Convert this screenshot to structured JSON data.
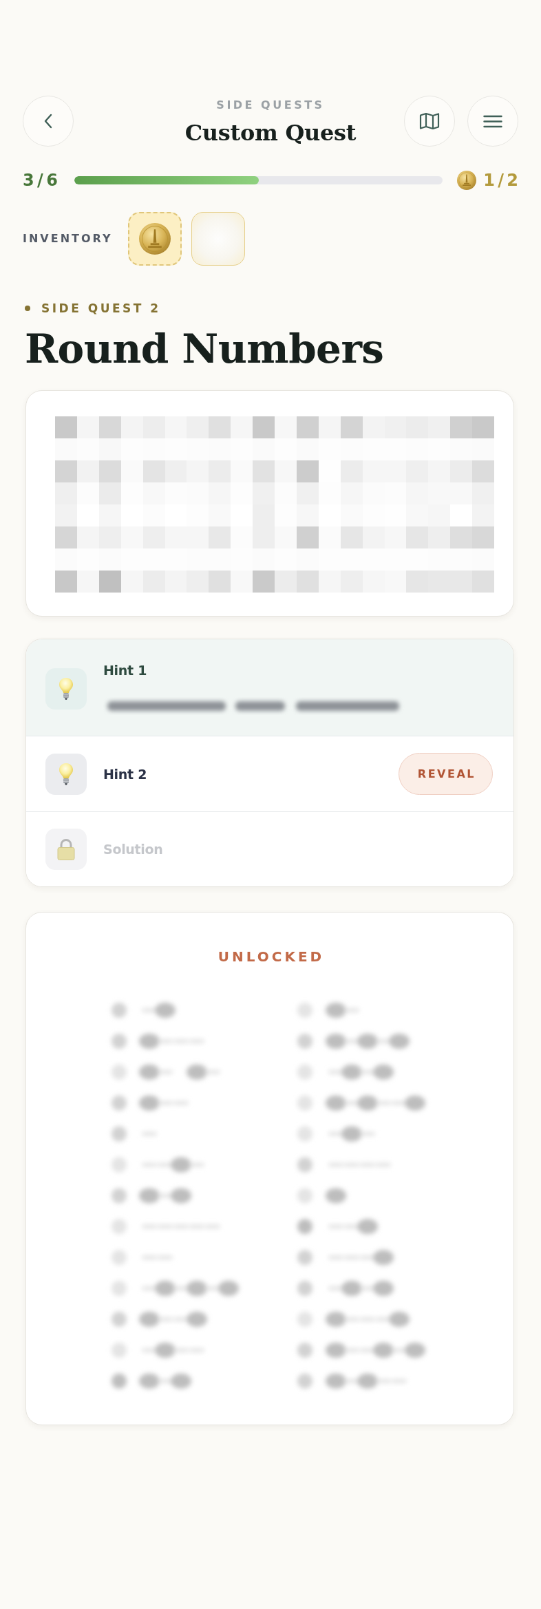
{
  "header": {
    "eyebrow": "SIDE QUESTS",
    "title": "Custom Quest"
  },
  "progress": {
    "count": "3 / 6",
    "level": 0.5,
    "coins": "1 / 2"
  },
  "inventory": {
    "label": "INVENTORY",
    "slots": [
      {
        "kind": "coin"
      },
      {
        "kind": "empty"
      }
    ]
  },
  "quest": {
    "eyebrow": "SIDE QUEST 2",
    "title": "Round Numbers"
  },
  "hints": [
    {
      "title": "Hint 1",
      "revealed": true,
      "locked": false
    },
    {
      "title": "Hint 2",
      "revealed": false,
      "locked": false,
      "button": "REVEAL"
    },
    {
      "title": "Solution",
      "revealed": false,
      "locked": true
    }
  ],
  "unlocked": {
    "label": "UNLOCKED"
  }
}
